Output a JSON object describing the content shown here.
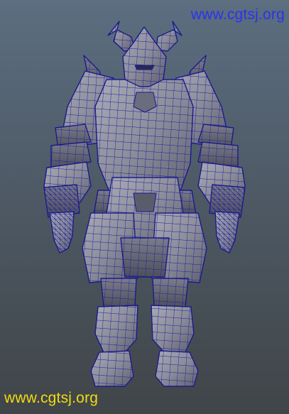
{
  "watermark": {
    "top_text": "www.cgtsj.org",
    "bottom_text": "www.cgtsj.org",
    "top_color": "#2a33ee",
    "bottom_color": "#f2dc10"
  },
  "viewport": {
    "background_top": "#5c6e80",
    "background_bottom": "#404548",
    "model": "armored-warrior-wireframe",
    "shading": "gray-shaded-with-blue-wireframe",
    "mesh_fill": "#8e8f9c",
    "wire_color": "#1e1e9e"
  }
}
